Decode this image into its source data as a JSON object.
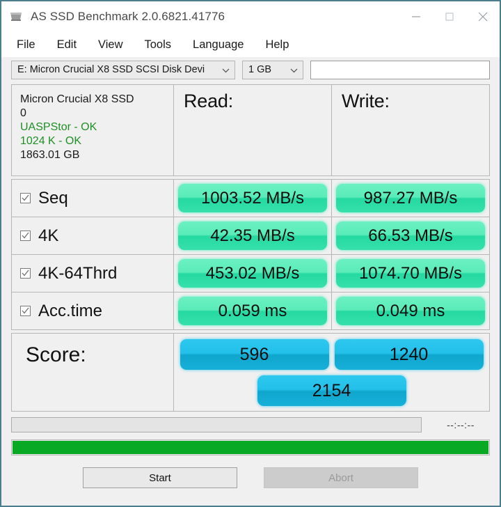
{
  "window": {
    "title": "AS SSD Benchmark 2.0.6821.41776",
    "icon": "ssd-drive-icon",
    "minimize_label": "Minimize",
    "maximize_label": "Maximize",
    "close_label": "Close",
    "border_color": "#4b7d8e"
  },
  "menu": {
    "items": [
      {
        "label": "File"
      },
      {
        "label": "Edit"
      },
      {
        "label": "View"
      },
      {
        "label": "Tools"
      },
      {
        "label": "Language"
      },
      {
        "label": "Help"
      }
    ]
  },
  "toolbar": {
    "device_select": "E: Micron Crucial X8 SSD SCSI Disk Devi",
    "size_select": "1 GB",
    "text_field_value": "",
    "text_field_placeholder": ""
  },
  "info": {
    "model": "Micron Crucial X8 SSD",
    "firmware": "0",
    "driver": "UASPStor - OK",
    "alignment": "1024 K - OK",
    "capacity": "1863.01 GB",
    "ok_color": "#1f8f26"
  },
  "columns": {
    "read": "Read:",
    "write": "Write:"
  },
  "rows": [
    {
      "name": "Seq",
      "checked": true,
      "read": "1003.52 MB/s",
      "write": "987.27 MB/s"
    },
    {
      "name": "4K",
      "checked": true,
      "read": "42.35 MB/s",
      "write": "66.53 MB/s"
    },
    {
      "name": "4K-64Thrd",
      "checked": true,
      "read": "453.02 MB/s",
      "write": "1074.70 MB/s"
    },
    {
      "name": "Acc.time",
      "checked": true,
      "read": "0.059 ms",
      "write": "0.049 ms"
    }
  ],
  "score": {
    "label": "Score:",
    "read": "596",
    "write": "1240",
    "total": "2154"
  },
  "status": {
    "message": "",
    "timer": "--:--:--",
    "progress_percent": 100,
    "progress_color": "#09a925"
  },
  "buttons": {
    "start": "Start",
    "abort": "Abort"
  },
  "colors": {
    "badge_green_top": "#6df0c3",
    "badge_green_bottom": "#25d9a1",
    "badge_blue_top": "#2fc8ee",
    "badge_blue_bottom": "#0fa6cd"
  },
  "chart_data": {
    "type": "table",
    "title": "AS SSD Benchmark results",
    "categories": [
      "Seq",
      "4K",
      "4K-64Thrd",
      "Acc.time"
    ],
    "series": [
      {
        "name": "Read",
        "values": [
          1003.52,
          42.35,
          453.02,
          0.059
        ],
        "units": [
          "MB/s",
          "MB/s",
          "MB/s",
          "ms"
        ]
      },
      {
        "name": "Write",
        "values": [
          987.27,
          66.53,
          1074.7,
          0.049
        ],
        "units": [
          "MB/s",
          "MB/s",
          "MB/s",
          "ms"
        ]
      }
    ],
    "scores": {
      "read": 596,
      "write": 1240,
      "total": 2154
    }
  }
}
